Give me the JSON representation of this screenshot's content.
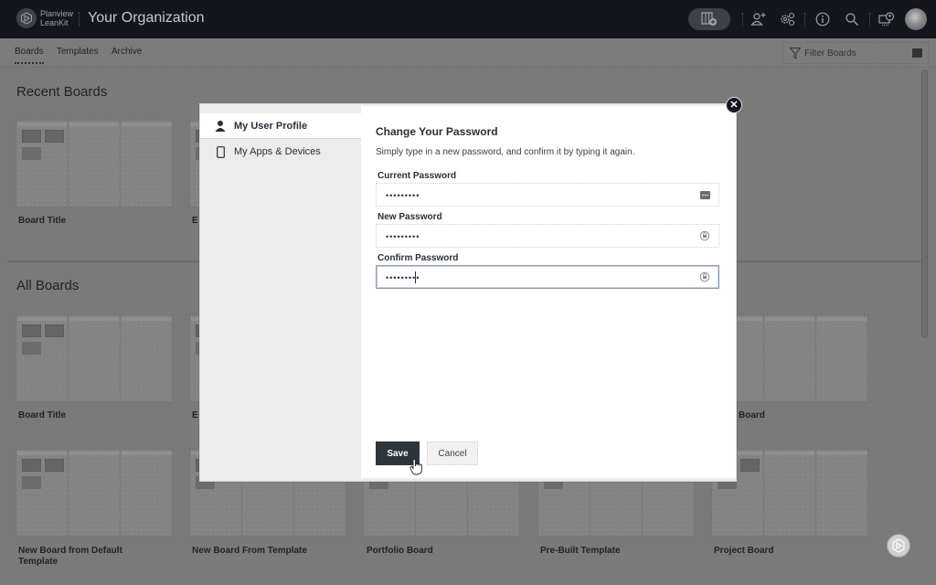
{
  "topbar": {
    "brand_line1": "Planview",
    "brand_line2": "LeanKit",
    "org_title": "Your Organization",
    "icons": [
      "new-board-icon",
      "add-user-icon",
      "settings-icon",
      "info-icon",
      "search-icon",
      "screen-share-icon",
      "user-avatar"
    ]
  },
  "subnav": {
    "tabs": [
      {
        "label": "Boards",
        "active": true
      },
      {
        "label": "Templates",
        "active": false
      },
      {
        "label": "Archive",
        "active": false
      }
    ],
    "filter_placeholder": "Filter Boards"
  },
  "sections": {
    "recent_title": "Recent Boards",
    "all_title": "All Boards"
  },
  "boards": {
    "recent": [
      {
        "title": "Board Title"
      },
      {
        "title": "E"
      }
    ],
    "all_row1": [
      {
        "title": "Board Title"
      },
      {
        "title": "E"
      },
      {
        "title": "Board"
      }
    ],
    "all_row2": [
      {
        "title": "New Board from Default Template"
      },
      {
        "title": "New Board From Template"
      },
      {
        "title": "Portfolio Board"
      },
      {
        "title": "Pre-Built Template"
      },
      {
        "title": "Project Board"
      }
    ]
  },
  "modal": {
    "sidebar": [
      {
        "label": "My User Profile",
        "icon": "user-icon",
        "active": true
      },
      {
        "label": "My Apps & Devices",
        "icon": "mobile-device-icon",
        "active": false
      }
    ],
    "title": "Change Your Password",
    "description": "Simply type in a new password, and confirm it by typing it again.",
    "fields": [
      {
        "label": "Current Password",
        "value": "•••••••••",
        "icon": "password-manager-icon"
      },
      {
        "label": "New Password",
        "value": "•••••••••",
        "icon": "lock-refresh-icon"
      },
      {
        "label": "Confirm Password",
        "value": "•••••••••",
        "icon": "lock-refresh-icon",
        "focused": true
      }
    ],
    "save_label": "Save",
    "cancel_label": "Cancel",
    "close_label": "✕"
  }
}
